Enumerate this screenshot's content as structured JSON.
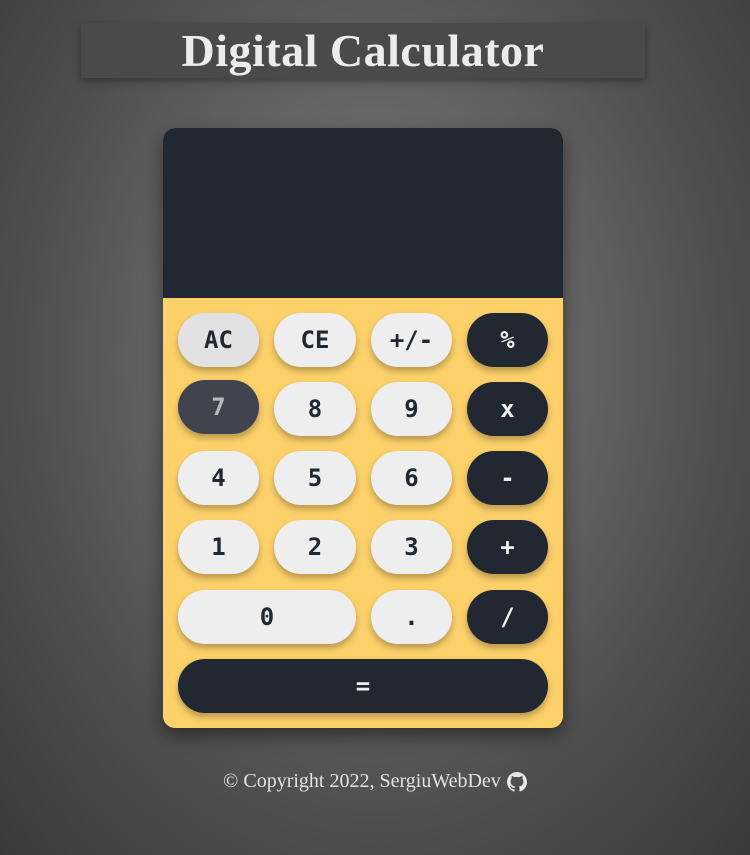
{
  "app": {
    "title": "Digital Calculator"
  },
  "display": {
    "value": ""
  },
  "keys": {
    "ac": "AC",
    "ce": "CE",
    "sign": "+/-",
    "percent": "%",
    "seven": "7",
    "eight": "8",
    "nine": "9",
    "multiply": "x",
    "four": "4",
    "five": "5",
    "six": "6",
    "subtract": "-",
    "one": "1",
    "two": "2",
    "three": "3",
    "add": "+",
    "zero": "0",
    "decimal": ".",
    "divide": "/",
    "equals": "="
  },
  "footer": {
    "copyright": "© Copyright 2022, SergiuWebDev",
    "icon": "github-icon"
  },
  "colors": {
    "background": "#6a6a6a",
    "calculator_body": "#fdd16a",
    "display": "#222831",
    "light_key": "#eeeeee",
    "dark_key": "#222831",
    "pressed_key": "#3f444e"
  }
}
